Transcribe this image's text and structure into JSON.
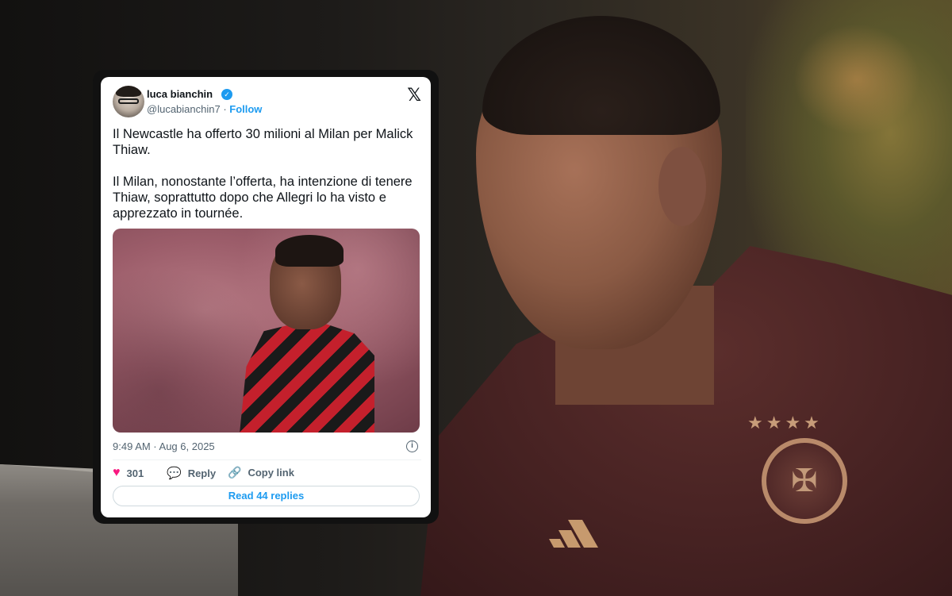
{
  "tweet": {
    "author_name": "luca bianchin",
    "handle": "@lucabianchin7",
    "separator": " · ",
    "follow_label": "Follow",
    "paragraphs": [
      "Il Newcastle ha offerto 30 milioni al Milan per Malick Thiaw.",
      "Il Milan, nonostante l’offerta, ha intenzione di tenere Thiaw, soprattutto dopo che Allegri lo ha visto e apprezzato in tournée."
    ],
    "timestamp": "9:49 AM · Aug 6, 2025",
    "likes_count": "301",
    "reply_label": "Reply",
    "copy_link_label": "Copy link",
    "read_replies_label": "Read 44 replies"
  },
  "icons": {
    "x_logo": "x-logo-icon",
    "verified": "verified-badge-icon",
    "like": "heart-icon",
    "reply": "reply-bubble-icon",
    "copy_link": "link-icon",
    "info": "info-icon"
  },
  "colors": {
    "accent": "#1d9bf0",
    "like": "#f91880",
    "text_primary": "#0f1419",
    "text_secondary": "#536471"
  }
}
